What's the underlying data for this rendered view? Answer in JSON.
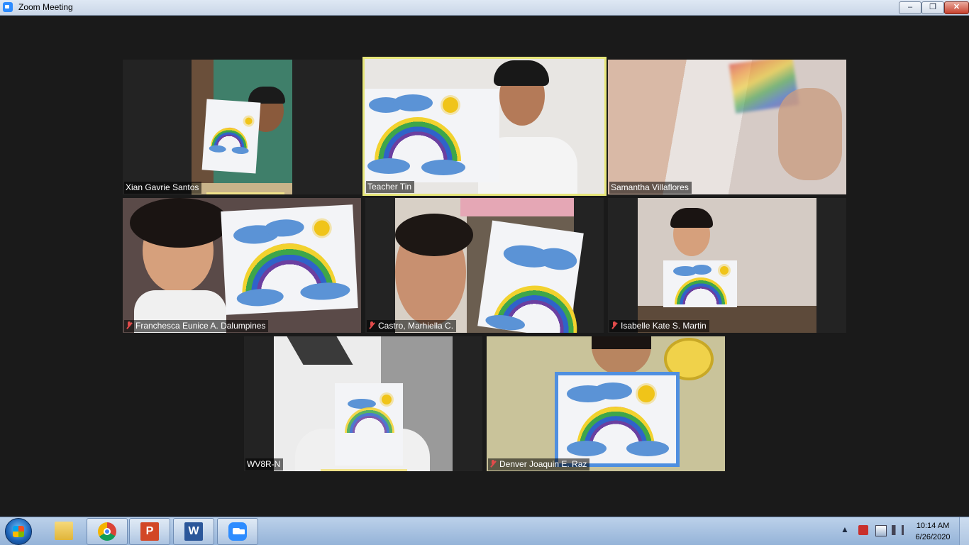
{
  "window": {
    "title": "Zoom Meeting",
    "controls": {
      "minimize": "–",
      "maximize": "❐",
      "close": "✕"
    }
  },
  "participants": [
    {
      "name": "Xian Gavrie Santos",
      "muted": false,
      "active_speaker": false
    },
    {
      "name": "Teacher Tin",
      "muted": false,
      "active_speaker": true
    },
    {
      "name": "Samantha Villaflores",
      "muted": false,
      "active_speaker": false
    },
    {
      "name": "Franchesca Eunice A. Dalumpines",
      "muted": true,
      "active_speaker": false
    },
    {
      "name": "Castro, Marhiella C.",
      "muted": true,
      "active_speaker": false
    },
    {
      "name": "Isabelle Kate S. Martin",
      "muted": true,
      "active_speaker": false
    },
    {
      "name": "WV8R-N",
      "muted": false,
      "active_speaker": false
    },
    {
      "name": "Denver Joaquin E. Raz",
      "muted": true,
      "active_speaker": false
    }
  ],
  "taskbar": {
    "apps": [
      {
        "name": "Windows Explorer",
        "icon": "folder-icon"
      },
      {
        "name": "Google Chrome",
        "icon": "chrome-icon"
      },
      {
        "name": "PowerPoint",
        "icon": "powerpoint-icon",
        "glyph": "P"
      },
      {
        "name": "Word",
        "icon": "word-icon",
        "glyph": "W"
      },
      {
        "name": "Zoom",
        "icon": "zoom-icon"
      }
    ],
    "tray": {
      "chevron": "▲"
    },
    "clock": {
      "time": "10:14 AM",
      "date": "6/26/2020"
    }
  },
  "colors": {
    "active_speaker_border": "#e6e67a",
    "mute_red": "#e24b4b",
    "meeting_bg": "#1a1a1a"
  }
}
